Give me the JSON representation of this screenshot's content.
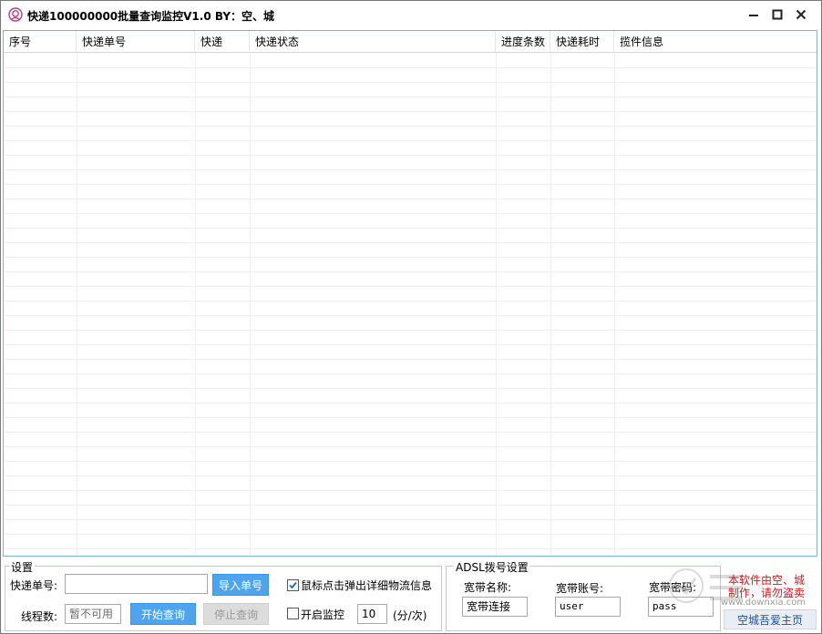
{
  "window": {
    "title": "快递100000000批量查询监控V1.0    BY：空、城",
    "minimize_label": "—",
    "maximize_label": "□",
    "close_label": "×"
  },
  "table": {
    "columns": [
      "序号",
      "快递单号",
      "快递",
      "快递状态",
      "进度条数",
      "快递耗时",
      "揽件信息"
    ],
    "rows": []
  },
  "settings": {
    "legend": "设置",
    "tracking_label": "快递单号:",
    "tracking_value": "",
    "import_button": "导入单号",
    "popup_checkbox_label": "鼠标点击弹出详细物流信息",
    "popup_checked": true,
    "threads_label": "线程数:",
    "threads_value": "暂不可用",
    "start_button": "开始查询",
    "stop_button": "停止查询",
    "monitor_checkbox_label": "开启监控",
    "monitor_checked": false,
    "interval_value": "10",
    "interval_unit": "(分/次)"
  },
  "adsl": {
    "legend": "ADSL拨号设置",
    "name_label": "宽带名称:",
    "name_value": "宽带连接",
    "account_label": "宽带账号:",
    "account_value": "user",
    "password_label": "宽带密码:",
    "password_value": "pass"
  },
  "footer": {
    "note_line1": "本软件由空、城",
    "note_line2": "制作，请勿盗卖",
    "homepage_link": "空城吾爱主页",
    "watermark_text": "www.downxia.com"
  },
  "colors": {
    "primary_button": "#4ea4ee",
    "note_red": "#d01818",
    "grid_border": "#82b3d6"
  }
}
